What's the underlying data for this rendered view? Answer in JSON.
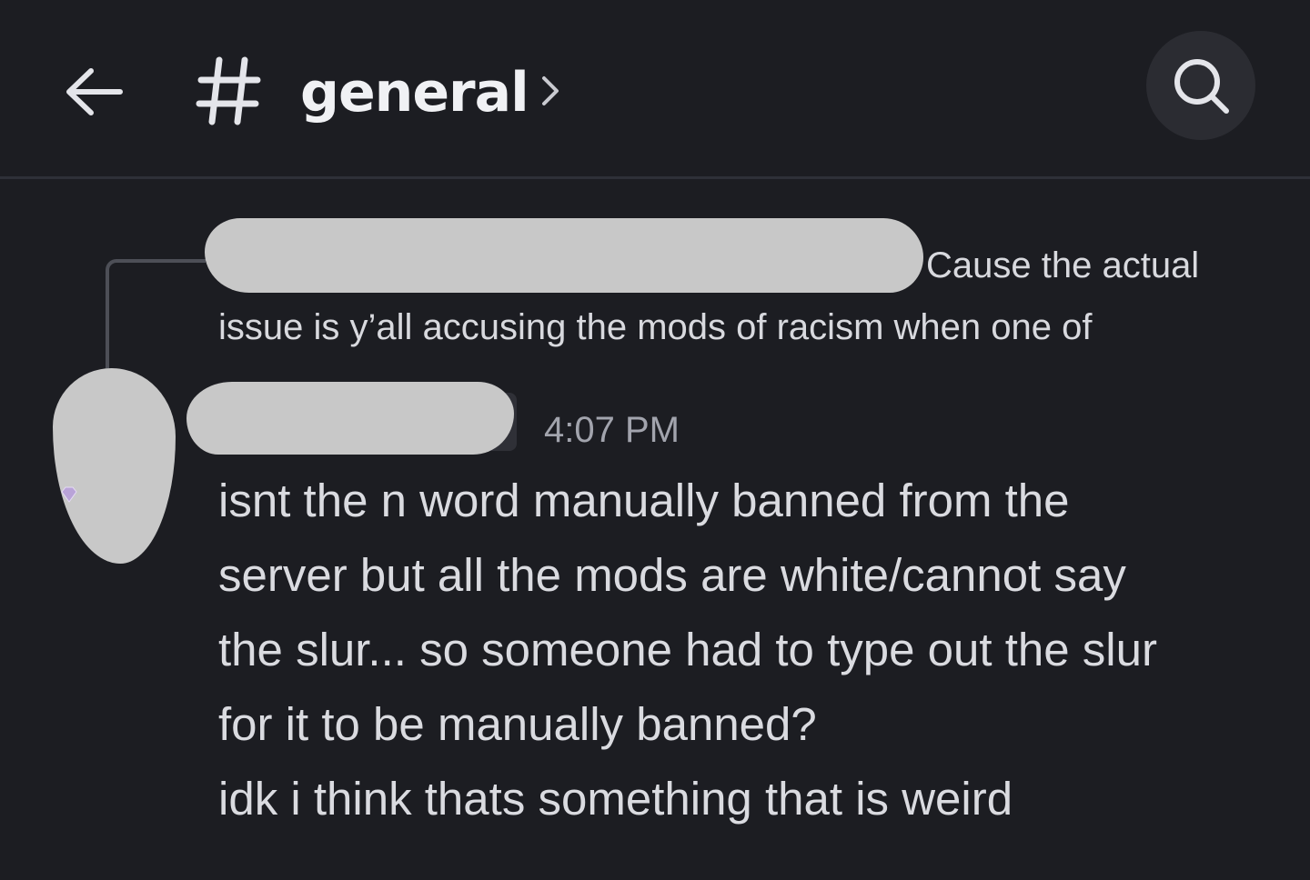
{
  "header": {
    "back_icon": "arrow-left-icon",
    "channel_icon": "hashtag-icon",
    "channel_name": "general",
    "chevron_icon": "chevron-right-icon",
    "search_icon": "search-icon"
  },
  "reply": {
    "author": "",
    "text": "Cause the actual issue is y’all accusing the mods of racism when one of"
  },
  "message": {
    "author": "",
    "timestamp": "4:07 PM",
    "lines": [
      "isnt the n word manually banned from the",
      "server but all the mods are white/cannot say",
      "the slur... so someone had to type out the slur",
      "for it to be manually banned?",
      "idk i think thats something that is weird"
    ]
  },
  "colors": {
    "background": "#1c1d22",
    "text": "#dadbe0",
    "muted": "#a2a4ad",
    "search_bg": "#2b2c32"
  }
}
